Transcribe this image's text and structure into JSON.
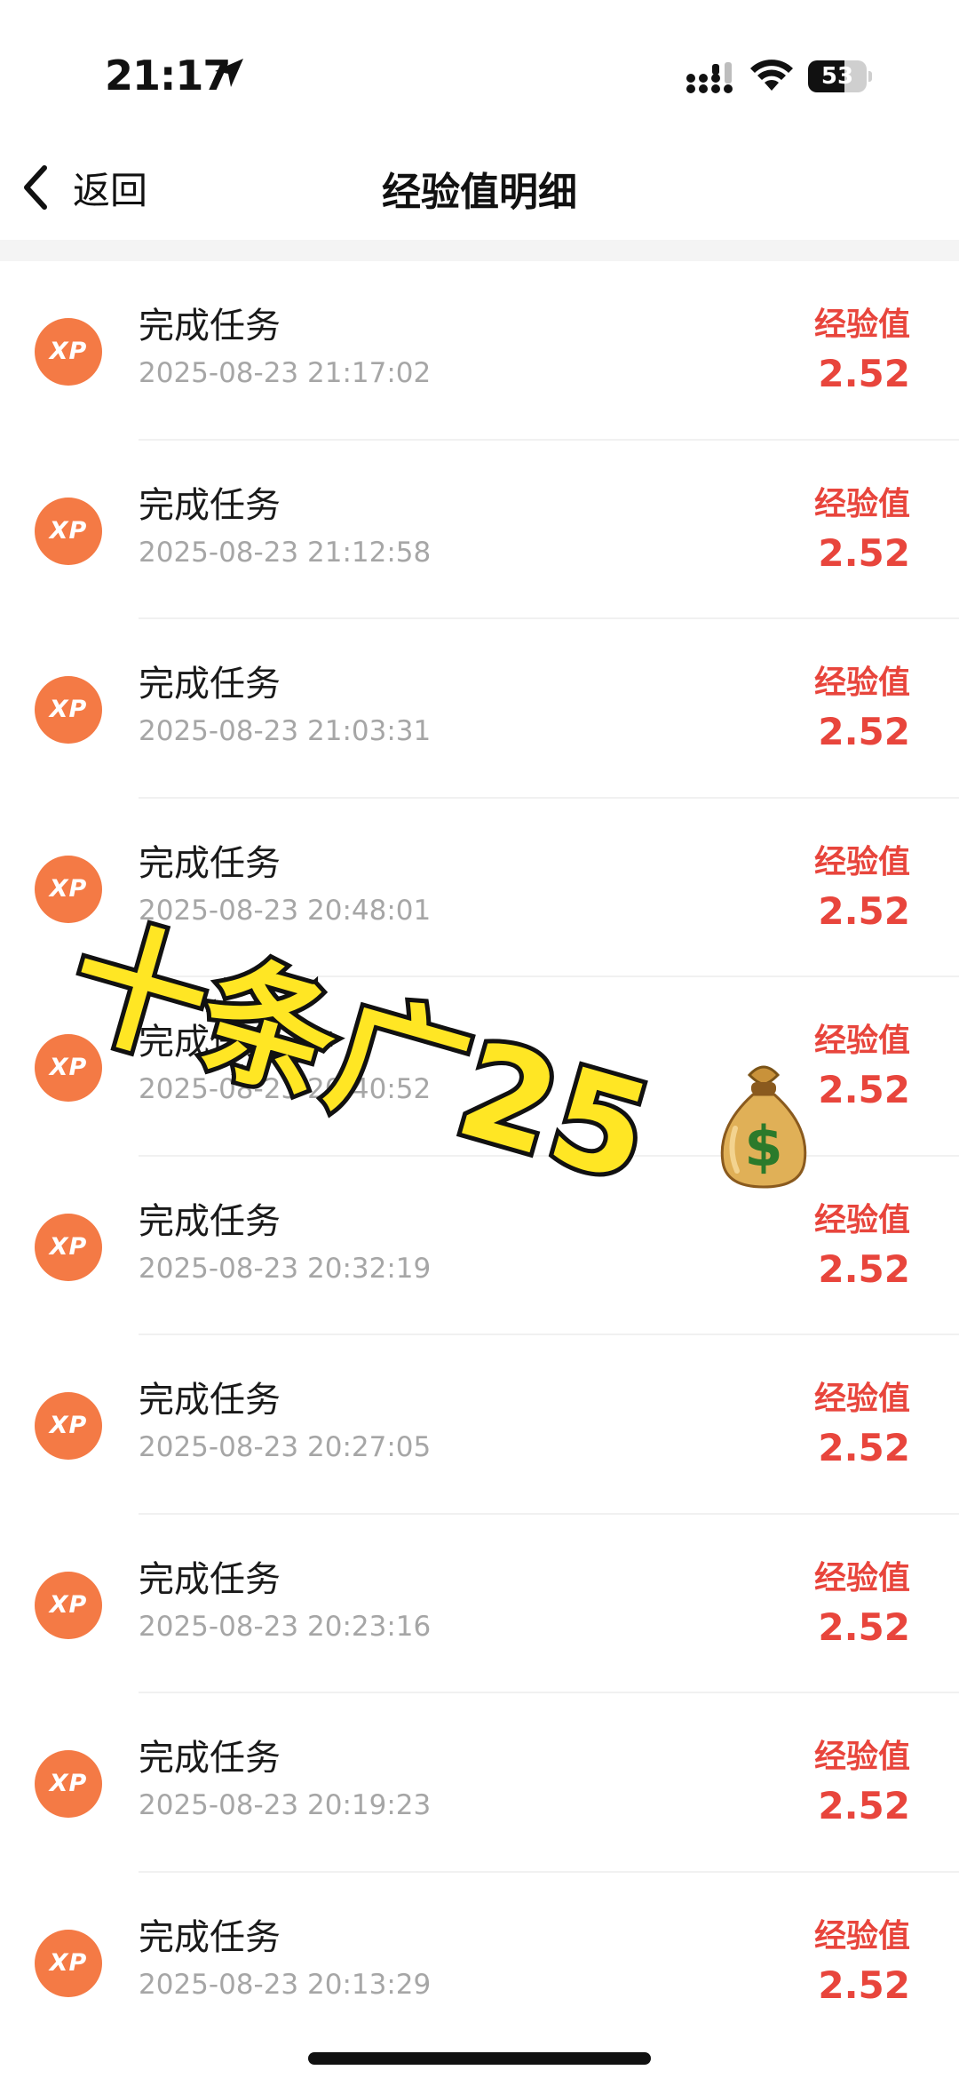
{
  "status_bar": {
    "time": "21:17",
    "battery": "53",
    "location_icon": "location-arrow-icon",
    "signal_icon": "cellular-signal-icon",
    "wifi_icon": "wifi-icon"
  },
  "nav": {
    "back_label": "返回",
    "back_icon": "chevron-left-icon",
    "title": "经验值明细"
  },
  "records": [
    {
      "badge": "XP",
      "title": "完成任务",
      "time": "2025-08-23 21:17:02",
      "label": "经验值",
      "value": "2.52"
    },
    {
      "badge": "XP",
      "title": "完成任务",
      "time": "2025-08-23 21:12:58",
      "label": "经验值",
      "value": "2.52"
    },
    {
      "badge": "XP",
      "title": "完成任务",
      "time": "2025-08-23 21:03:31",
      "label": "经验值",
      "value": "2.52"
    },
    {
      "badge": "XP",
      "title": "完成任务",
      "time": "2025-08-23 20:48:01",
      "label": "经验值",
      "value": "2.52"
    },
    {
      "badge": "XP",
      "title": "完成任务",
      "time": "2025-08-23 20:40:52",
      "label": "经验值",
      "value": "2.52"
    },
    {
      "badge": "XP",
      "title": "完成任务",
      "time": "2025-08-23 20:32:19",
      "label": "经验值",
      "value": "2.52"
    },
    {
      "badge": "XP",
      "title": "完成任务",
      "time": "2025-08-23 20:27:05",
      "label": "经验值",
      "value": "2.52"
    },
    {
      "badge": "XP",
      "title": "完成任务",
      "time": "2025-08-23 20:23:16",
      "label": "经验值",
      "value": "2.52"
    },
    {
      "badge": "XP",
      "title": "完成任务",
      "time": "2025-08-23 20:19:23",
      "label": "经验值",
      "value": "2.52"
    },
    {
      "badge": "XP",
      "title": "完成任务",
      "time": "2025-08-23 20:13:29",
      "label": "经验值",
      "value": "2.52"
    }
  ],
  "overlay": {
    "text": "十条广25",
    "icon": "money-bag-icon"
  },
  "colors": {
    "accent_red": "#e8453c",
    "xp_orange": "#f47a45",
    "sticker_yellow": "#ffe624"
  }
}
